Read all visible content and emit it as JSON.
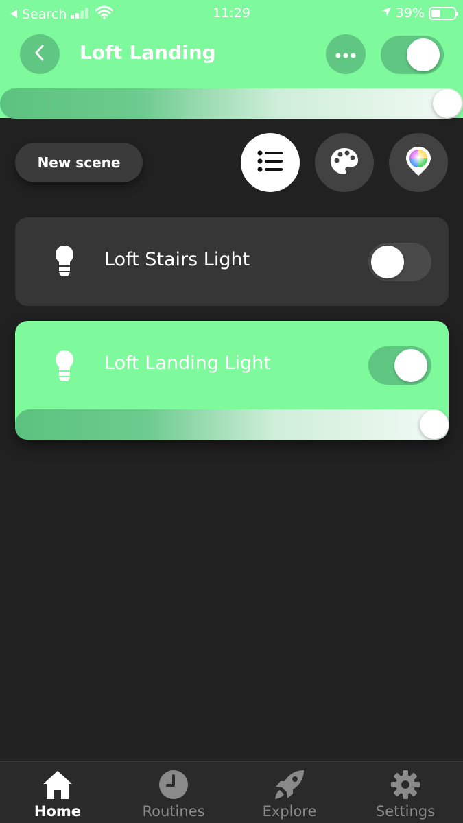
{
  "status_bar": {
    "back_app": "Search",
    "time": "11:29",
    "battery": "39%"
  },
  "header": {
    "title": "Loft Landing",
    "accent_color": "#7ef99c",
    "room_on": true,
    "brightness_percent": 100
  },
  "controls": {
    "new_scene_label": "New scene",
    "view_buttons": [
      "list-icon",
      "palette-icon",
      "color-picker-icon"
    ],
    "active_view": "list-icon"
  },
  "lights": [
    {
      "name": "Loft Stairs Light",
      "on": false
    },
    {
      "name": "Loft Landing Light",
      "on": true,
      "brightness_percent": 100
    }
  ],
  "nav": {
    "items": [
      {
        "label": "Home",
        "icon": "home-icon",
        "active": true
      },
      {
        "label": "Routines",
        "icon": "clock-icon",
        "active": false
      },
      {
        "label": "Explore",
        "icon": "rocket-icon",
        "active": false
      },
      {
        "label": "Settings",
        "icon": "gear-icon",
        "active": false
      }
    ]
  }
}
